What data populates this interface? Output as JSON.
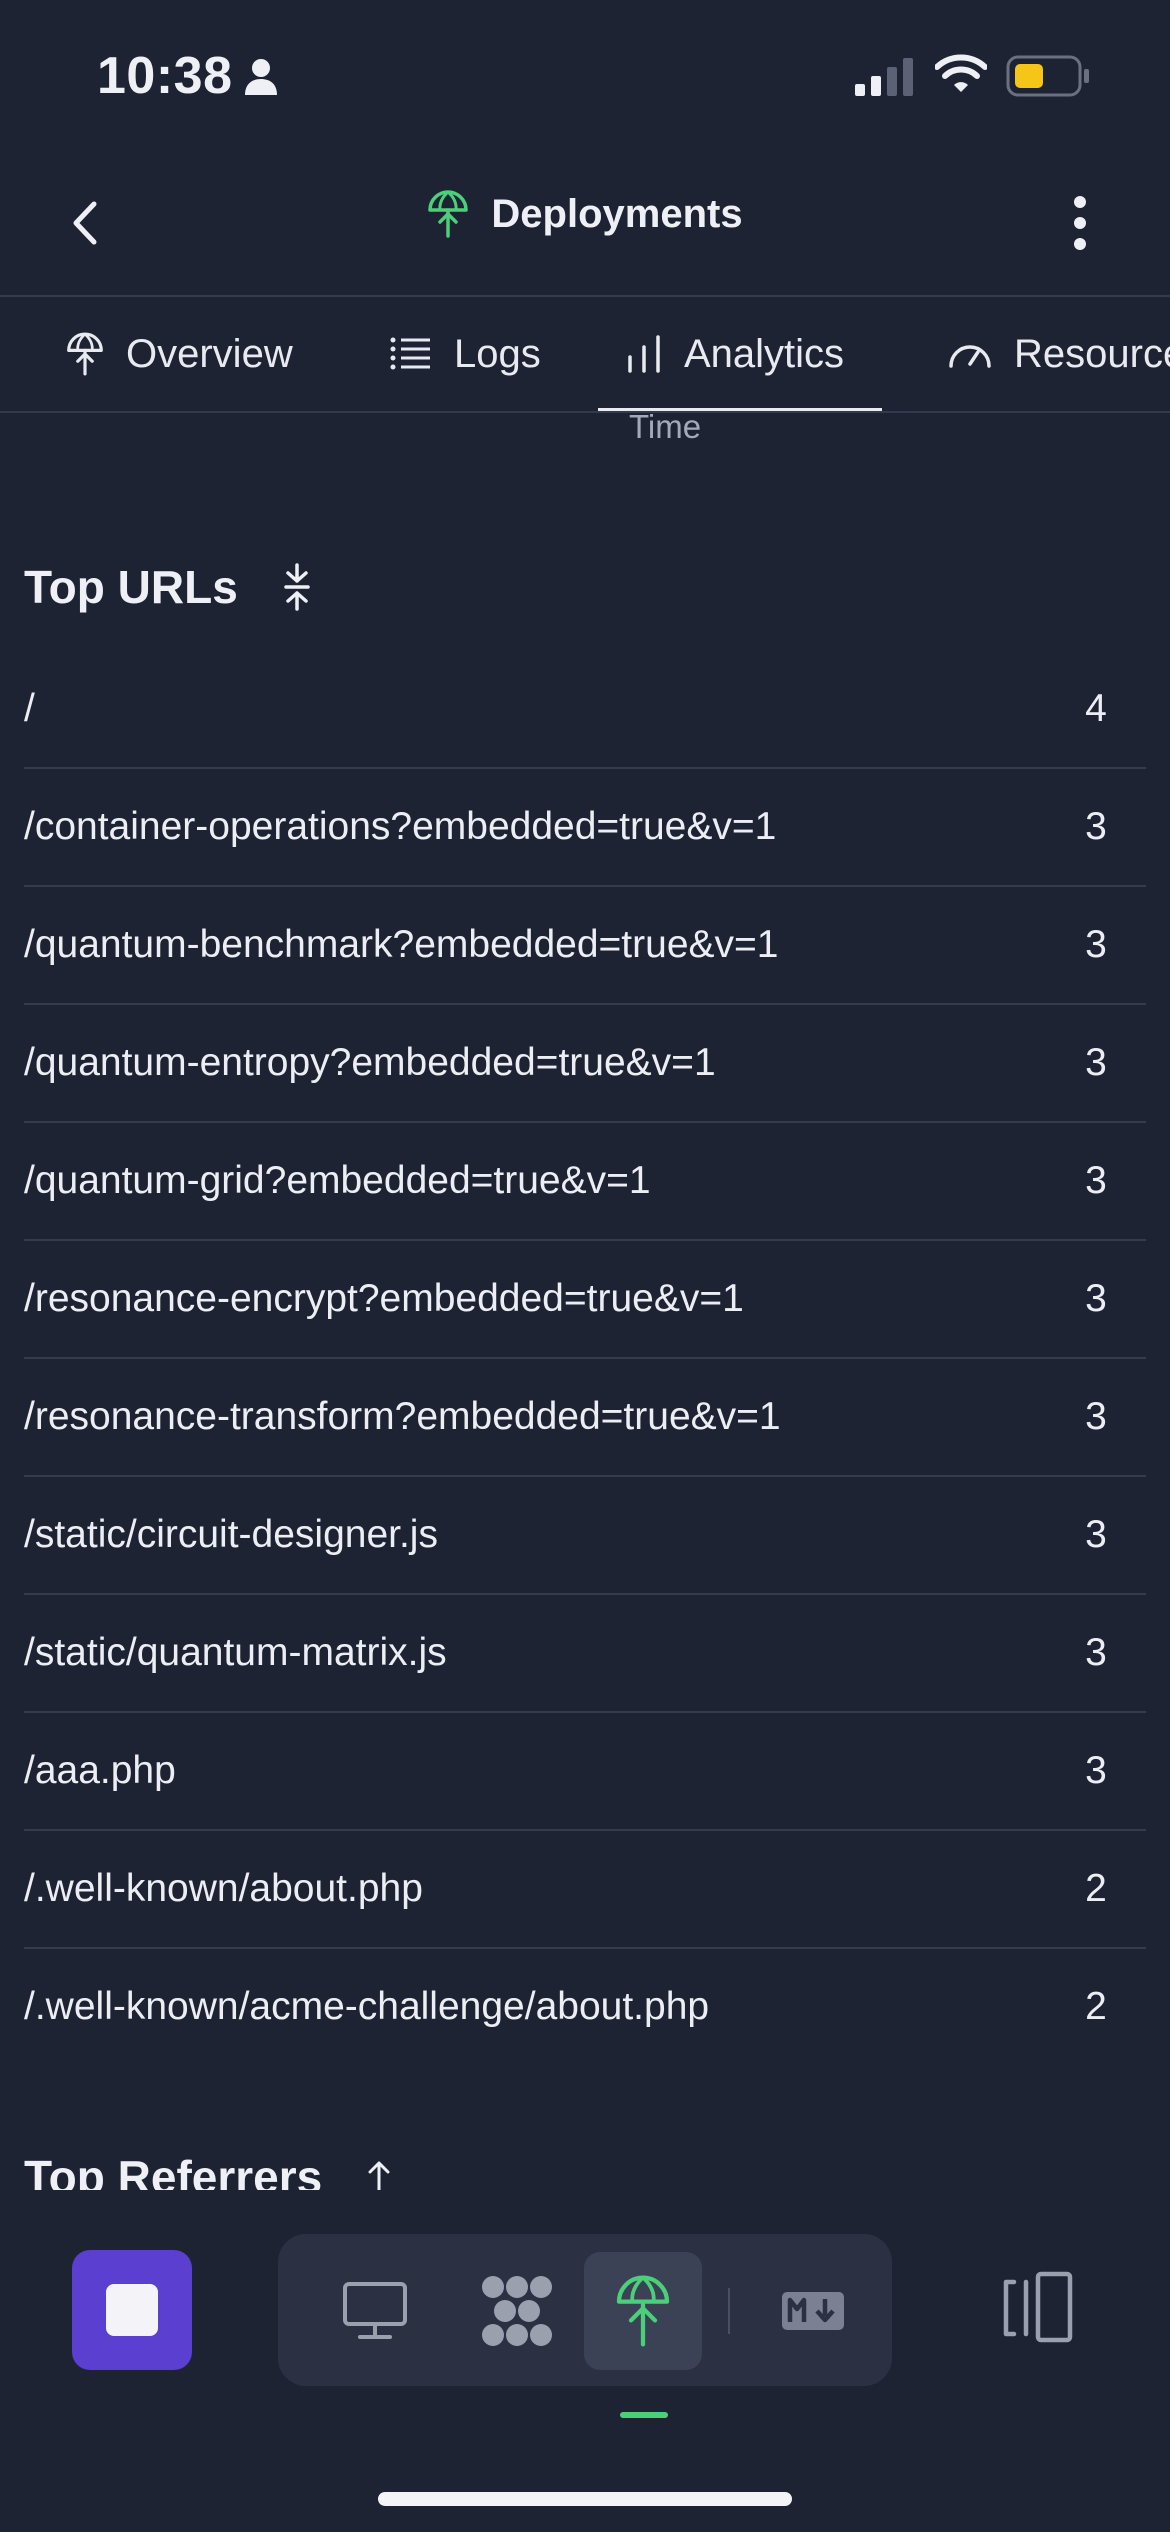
{
  "status_bar": {
    "time": "10:38",
    "battery_color": "#f5c518"
  },
  "nav": {
    "title": "Deployments",
    "title_icon": "deployment-icon",
    "accent": "#4ccf7a"
  },
  "tabs": [
    {
      "label": "Overview",
      "icon": "deployment-icon"
    },
    {
      "label": "Logs",
      "icon": "list-icon"
    },
    {
      "label": "Analytics",
      "icon": "bar-chart-icon",
      "active": true
    },
    {
      "label": "Resources",
      "icon": "gauge-icon"
    }
  ],
  "time_label": "Time",
  "top_urls": {
    "title": "Top URLs",
    "icon": "collapse-icon",
    "rows": [
      {
        "url": "/",
        "count": "4"
      },
      {
        "url": "/container-operations?embedded=true&v=1",
        "count": "3"
      },
      {
        "url": "/quantum-benchmark?embedded=true&v=1",
        "count": "3"
      },
      {
        "url": "/quantum-entropy?embedded=true&v=1",
        "count": "3"
      },
      {
        "url": "/quantum-grid?embedded=true&v=1",
        "count": "3"
      },
      {
        "url": "/resonance-encrypt?embedded=true&v=1",
        "count": "3"
      },
      {
        "url": "/resonance-transform?embedded=true&v=1",
        "count": "3"
      },
      {
        "url": "/static/circuit-designer.js",
        "count": "3"
      },
      {
        "url": "/static/quantum-matrix.js",
        "count": "3"
      },
      {
        "url": "/aaa.php",
        "count": "3"
      },
      {
        "url": "/.well-known/about.php",
        "count": "2"
      },
      {
        "url": "/.well-known/acme-challenge/about.php",
        "count": "2"
      }
    ]
  },
  "top_referrers": {
    "title": "Top Referrers",
    "icon": "arrow-up-icon"
  },
  "bottom_bar": {
    "stop_color": "#5a3fd1",
    "dock_items": [
      "monitor-icon",
      "apps-icon",
      "deployment-icon",
      "markdown-icon"
    ],
    "active_item": "deployment-icon"
  }
}
